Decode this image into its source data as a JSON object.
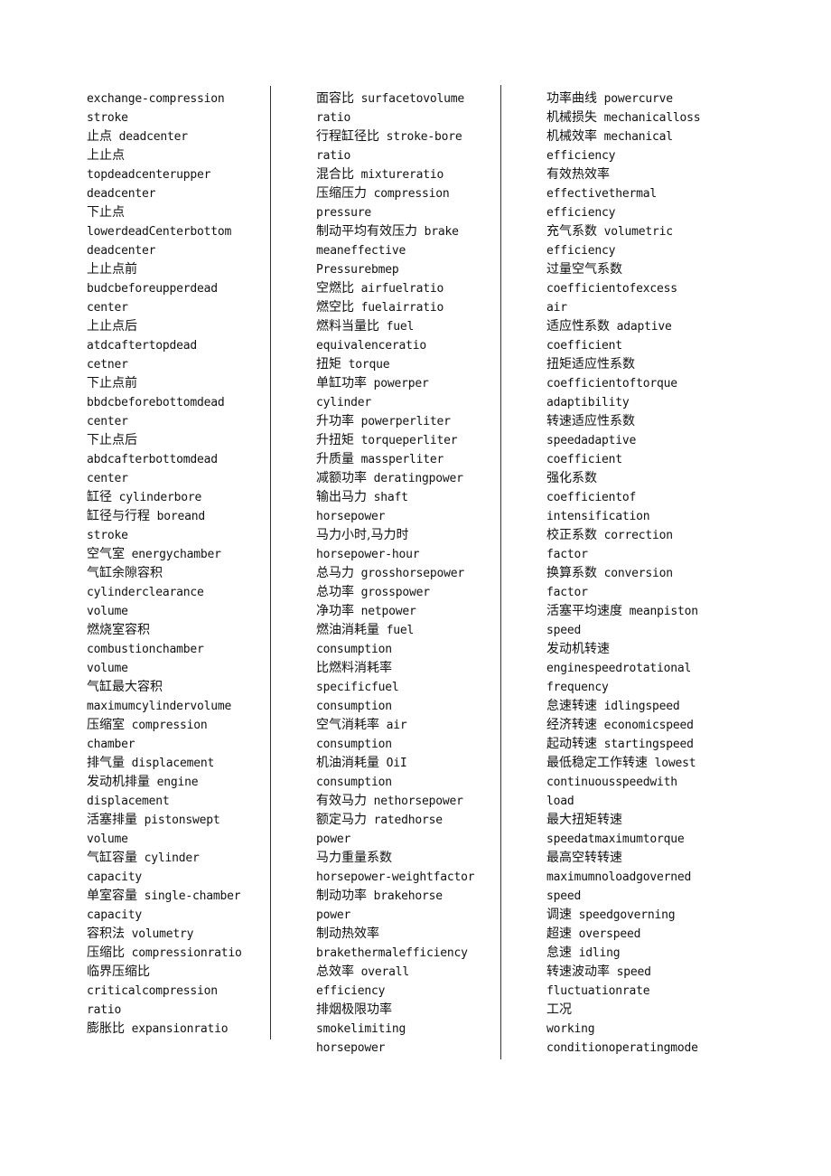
{
  "document": {
    "columns": [
      {
        "lines": [
          {
            "zh": "",
            "en": "exchange-compression"
          },
          {
            "zh": "",
            "en": "stroke"
          },
          {
            "zh": "止点",
            "en": "deadcenter"
          },
          {
            "zh": "上止点",
            "en": ""
          },
          {
            "zh": "",
            "en": "topdeadcenterupper"
          },
          {
            "zh": "",
            "en": "deadcenter"
          },
          {
            "zh": "下止点",
            "en": ""
          },
          {
            "zh": "",
            "en": "lowerdeadCenterbottom"
          },
          {
            "zh": "",
            "en": "deadcenter"
          },
          {
            "zh": "上止点前",
            "en": ""
          },
          {
            "zh": "",
            "en": "budcbeforeupperdead"
          },
          {
            "zh": "",
            "en": "center"
          },
          {
            "zh": "上止点后",
            "en": ""
          },
          {
            "zh": "",
            "en": "atdcaftertopdead"
          },
          {
            "zh": "",
            "en": "cetner"
          },
          {
            "zh": "下止点前",
            "en": ""
          },
          {
            "zh": "",
            "en": "bbdcbeforebottomdead"
          },
          {
            "zh": "",
            "en": "center"
          },
          {
            "zh": "下止点后",
            "en": ""
          },
          {
            "zh": "",
            "en": "abdcafterbottomdead"
          },
          {
            "zh": "",
            "en": "center"
          },
          {
            "zh": "缸径",
            "en": "cylinderbore"
          },
          {
            "zh": "缸径与行程",
            "en": "boreand"
          },
          {
            "zh": "",
            "en": "stroke"
          },
          {
            "zh": "空气室",
            "en": "energychamber"
          },
          {
            "zh": "气缸余隙容积",
            "en": ""
          },
          {
            "zh": "",
            "en": "cylinderclearance"
          },
          {
            "zh": "",
            "en": "volume"
          },
          {
            "zh": "燃烧室容积",
            "en": ""
          },
          {
            "zh": "",
            "en": "combustionchamber"
          },
          {
            "zh": "",
            "en": "volume"
          },
          {
            "zh": "气缸最大容积",
            "en": ""
          },
          {
            "zh": "",
            "en": "maximumcylindervolume"
          },
          {
            "zh": "压缩室",
            "en": "compression"
          },
          {
            "zh": "",
            "en": "chamber"
          },
          {
            "zh": "排气量",
            "en": "displacement"
          },
          {
            "zh": "发动机排量",
            "en": "engine"
          },
          {
            "zh": "",
            "en": "displacement"
          },
          {
            "zh": "活塞排量",
            "en": "pistonswept"
          },
          {
            "zh": "",
            "en": "volume"
          },
          {
            "zh": "气缸容量",
            "en": "cylinder"
          },
          {
            "zh": "",
            "en": "capacity"
          },
          {
            "zh": "单室容量",
            "en": "single-chamber"
          },
          {
            "zh": "",
            "en": "capacity"
          },
          {
            "zh": "容积法",
            "en": "volumetry"
          },
          {
            "zh": "压缩比",
            "en": "compressionratio"
          },
          {
            "zh": "临界压缩比",
            "en": ""
          },
          {
            "zh": "",
            "en": "criticalcompression"
          },
          {
            "zh": "",
            "en": "ratio"
          },
          {
            "zh": "膨胀比",
            "en": "expansionratio"
          }
        ]
      },
      {
        "lines": [
          {
            "zh": "面容比",
            "en": "surfacetovolume"
          },
          {
            "zh": "",
            "en": "ratio"
          },
          {
            "zh": "行程缸径比",
            "en": "stroke-bore"
          },
          {
            "zh": "",
            "en": "ratio"
          },
          {
            "zh": "混合比",
            "en": "mixtureratio"
          },
          {
            "zh": "压缩压力",
            "en": "compression"
          },
          {
            "zh": "",
            "en": "pressure"
          },
          {
            "zh": "制动平均有效压力",
            "en": "brake"
          },
          {
            "zh": "",
            "en": "meaneffective"
          },
          {
            "zh": "",
            "en": "Pressurebmep"
          },
          {
            "zh": "空燃比",
            "en": "airfuelratio"
          },
          {
            "zh": "燃空比",
            "en": "fuelairratio"
          },
          {
            "zh": "燃料当量比",
            "en": "fuel"
          },
          {
            "zh": "",
            "en": "equivalenceratio"
          },
          {
            "zh": "扭矩",
            "en": "torque"
          },
          {
            "zh": "单缸功率",
            "en": "powerper"
          },
          {
            "zh": "",
            "en": "cylinder"
          },
          {
            "zh": "升功率",
            "en": "powerperliter"
          },
          {
            "zh": "升扭矩",
            "en": "torqueperliter"
          },
          {
            "zh": "升质量",
            "en": "massperliter"
          },
          {
            "zh": "减额功率",
            "en": "deratingpower"
          },
          {
            "zh": "输出马力",
            "en": "shaft"
          },
          {
            "zh": "",
            "en": "horsepower"
          },
          {
            "zh": "马力小时,马力时",
            "en": ""
          },
          {
            "zh": "",
            "en": "horsepower-hour"
          },
          {
            "zh": "总马力",
            "en": "grosshorsepower"
          },
          {
            "zh": "总功率",
            "en": "grosspower"
          },
          {
            "zh": "净功率",
            "en": "netpower"
          },
          {
            "zh": "燃油消耗量",
            "en": "fuel"
          },
          {
            "zh": "",
            "en": "consumption"
          },
          {
            "zh": "比燃料消耗率",
            "en": ""
          },
          {
            "zh": "",
            "en": "specificfuel"
          },
          {
            "zh": "",
            "en": "consumption"
          },
          {
            "zh": "空气消耗率",
            "en": "air"
          },
          {
            "zh": "",
            "en": "consumption"
          },
          {
            "zh": "机油消耗量",
            "en": "OiI"
          },
          {
            "zh": "",
            "en": "consumption"
          },
          {
            "zh": "有效马力",
            "en": "nethorsepower"
          },
          {
            "zh": "额定马力",
            "en": "ratedhorse"
          },
          {
            "zh": "",
            "en": "power"
          },
          {
            "zh": "马力重量系数",
            "en": ""
          },
          {
            "zh": "",
            "en": "horsepower-weightfactor"
          },
          {
            "zh": "制动功率",
            "en": "brakehorse"
          },
          {
            "zh": "",
            "en": "power"
          },
          {
            "zh": "制动热效率",
            "en": ""
          },
          {
            "zh": "",
            "en": "brakethermalefficiency"
          },
          {
            "zh": "总效率",
            "en": "overall"
          },
          {
            "zh": "",
            "en": "efficiency"
          },
          {
            "zh": "排烟极限功率",
            "en": ""
          },
          {
            "zh": "",
            "en": "smokelimiting"
          },
          {
            "zh": "",
            "en": "horsepower"
          }
        ]
      },
      {
        "lines": [
          {
            "zh": "功率曲线",
            "en": "powercurve"
          },
          {
            "zh": "机械损失",
            "en": "mechanicalloss"
          },
          {
            "zh": "机械效率",
            "en": "mechanical"
          },
          {
            "zh": "",
            "en": "efficiency"
          },
          {
            "zh": "有效热效率",
            "en": ""
          },
          {
            "zh": "",
            "en": "effectivethermal"
          },
          {
            "zh": "",
            "en": "efficiency"
          },
          {
            "zh": "充气系数",
            "en": "volumetric"
          },
          {
            "zh": "",
            "en": "efficiency"
          },
          {
            "zh": "过量空气系数",
            "en": ""
          },
          {
            "zh": "",
            "en": "coefficientofexcess"
          },
          {
            "zh": "",
            "en": "air"
          },
          {
            "zh": "适应性系数",
            "en": "adaptive"
          },
          {
            "zh": "",
            "en": "coefficient"
          },
          {
            "zh": "扭矩适应性系数",
            "en": ""
          },
          {
            "zh": "",
            "en": "coefficientoftorque"
          },
          {
            "zh": "",
            "en": "adaptibility"
          },
          {
            "zh": "转速适应性系数",
            "en": ""
          },
          {
            "zh": "",
            "en": "speedadaptive"
          },
          {
            "zh": "",
            "en": "coefficient"
          },
          {
            "zh": "强化系数",
            "en": ""
          },
          {
            "zh": "",
            "en": "coefficientof"
          },
          {
            "zh": "",
            "en": "intensification"
          },
          {
            "zh": "校正系数",
            "en": "correction"
          },
          {
            "zh": "",
            "en": "factor"
          },
          {
            "zh": "换算系数",
            "en": "conversion"
          },
          {
            "zh": "",
            "en": "factor"
          },
          {
            "zh": "活塞平均速度",
            "en": "meanpiston"
          },
          {
            "zh": "",
            "en": "speed"
          },
          {
            "zh": "发动机转速",
            "en": ""
          },
          {
            "zh": "",
            "en": "enginespeedrotational"
          },
          {
            "zh": "",
            "en": "frequency"
          },
          {
            "zh": "怠速转速",
            "en": "idlingspeed"
          },
          {
            "zh": "经济转速",
            "en": "economicspeed"
          },
          {
            "zh": "起动转速",
            "en": "startingspeed"
          },
          {
            "zh": "最低稳定工作转速",
            "en": "lowest"
          },
          {
            "zh": "",
            "en": "continuousspeedwith"
          },
          {
            "zh": "",
            "en": "load"
          },
          {
            "zh": "最大扭矩转速",
            "en": ""
          },
          {
            "zh": "",
            "en": "speedatmaximumtorque"
          },
          {
            "zh": "最高空转转速",
            "en": ""
          },
          {
            "zh": "",
            "en": "maximumnoloadgoverned"
          },
          {
            "zh": "",
            "en": "speed"
          },
          {
            "zh": "调速",
            "en": "speedgoverning"
          },
          {
            "zh": "超速",
            "en": "overspeed"
          },
          {
            "zh": "怠速",
            "en": "idling"
          },
          {
            "zh": "转速波动率",
            "en": "speed"
          },
          {
            "zh": "",
            "en": "fluctuationrate"
          },
          {
            "zh": "工况",
            "en": ""
          },
          {
            "zh": "",
            "en": "working"
          },
          {
            "zh": "",
            "en": "conditionoperatingmode"
          }
        ]
      }
    ]
  }
}
